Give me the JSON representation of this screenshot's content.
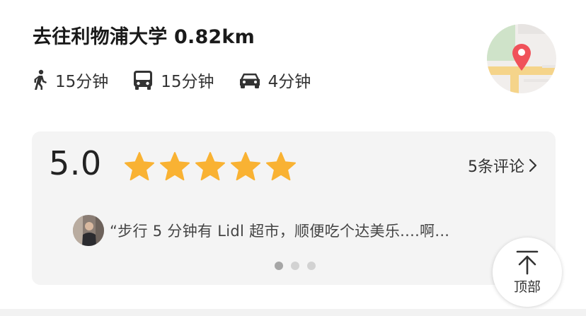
{
  "route": {
    "title": "去往利物浦大学 0.82km",
    "modes": [
      {
        "icon": "walk-icon",
        "time": "15分钟"
      },
      {
        "icon": "bus-icon",
        "time": "15分钟"
      },
      {
        "icon": "car-icon",
        "time": "4分钟"
      }
    ],
    "map_icon": "map-pin-icon"
  },
  "review": {
    "rating": "5.0",
    "stars_filled": 5,
    "stars_total": 5,
    "count_label": "5条评论",
    "snippet": "“步行 5 分钟有 Lidl 超市，顺便吃个达美乐....啊...",
    "carousel": {
      "pages": 3,
      "active_index": 0
    }
  },
  "float_button": {
    "label": "顶部"
  },
  "colors": {
    "star": "#F9B233",
    "pin": "#F0525A",
    "card_bg": "#F4F4F4"
  }
}
